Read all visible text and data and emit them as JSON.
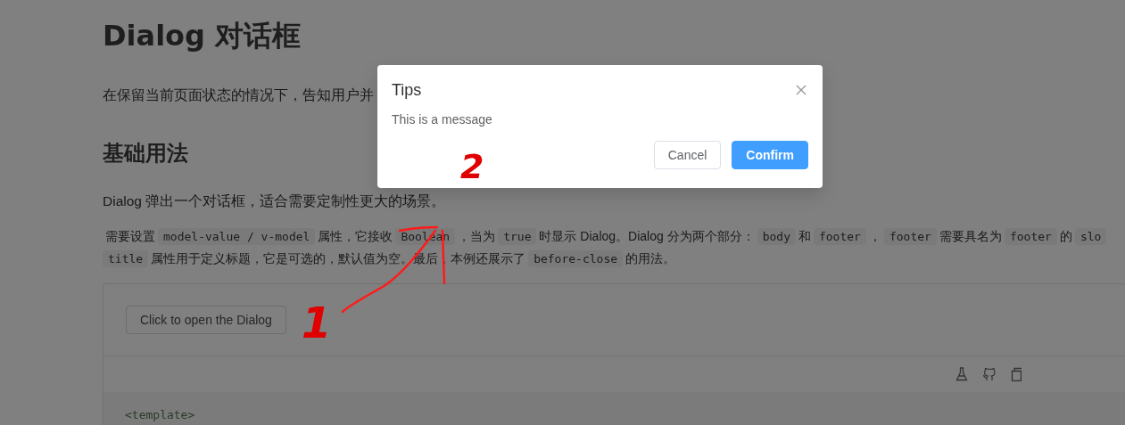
{
  "page": {
    "title": "Dialog 对话框",
    "intro": "在保留当前页面状态的情况下，告知用户并",
    "section_title": "基础用法",
    "description": "Dialog 弹出一个对话框，适合需要定制性更大的场景。",
    "details": [
      [
        {
          "kind": "text",
          "text": "需要设置"
        },
        {
          "kind": "code",
          "text": "model-value / v-model"
        },
        {
          "kind": "text",
          "text": "属性，它接收"
        },
        {
          "kind": "code",
          "text": "Boolean"
        },
        {
          "kind": "text",
          "text": "，当为"
        },
        {
          "kind": "code",
          "text": "true"
        },
        {
          "kind": "text",
          "text": "时显示 Dialog。Dialog 分为两个部分："
        },
        {
          "kind": "code",
          "text": "body"
        },
        {
          "kind": "text",
          "text": "和"
        },
        {
          "kind": "code",
          "text": "footer"
        },
        {
          "kind": "text",
          "text": "，"
        },
        {
          "kind": "code",
          "text": "footer"
        },
        {
          "kind": "text",
          "text": "需要具名为"
        },
        {
          "kind": "code",
          "text": "footer"
        },
        {
          "kind": "text",
          "text": "的"
        },
        {
          "kind": "code",
          "text": "slo"
        }
      ],
      [
        {
          "kind": "code",
          "text": "title"
        },
        {
          "kind": "text",
          "text": "属性用于定义标题，它是可选的，默认值为空。最后，本例还展示了"
        },
        {
          "kind": "code",
          "text": "before-close"
        },
        {
          "kind": "text",
          "text": "的用法。"
        }
      ]
    ],
    "demo": {
      "button": "Click to open the Dialog",
      "code_line": "<template>"
    }
  },
  "dialog": {
    "title": "Tips",
    "message": "This is a message",
    "buttons": [
      {
        "label": "Cancel",
        "kind": "default"
      },
      {
        "label": "Confirm",
        "kind": "primary"
      }
    ]
  },
  "annotations": [
    {
      "label": "1"
    },
    {
      "label": "2"
    }
  ]
}
